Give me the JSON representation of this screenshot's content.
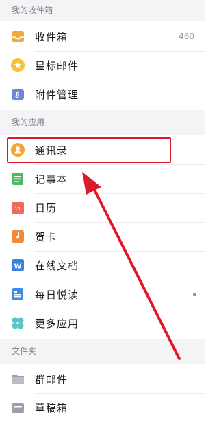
{
  "sections": {
    "mailbox": "我的收件箱",
    "apps": "我的应用",
    "folders": "文件夹"
  },
  "mailbox_items": [
    {
      "label": "收件箱",
      "count": "460",
      "icon": "inbox-icon"
    },
    {
      "label": "星标邮件",
      "icon": "star-icon"
    },
    {
      "label": "附件管理",
      "icon": "attachment-icon"
    }
  ],
  "app_items": [
    {
      "label": "通讯录",
      "icon": "contacts-icon"
    },
    {
      "label": "记事本",
      "icon": "notepad-icon"
    },
    {
      "label": "日历",
      "icon": "calendar-icon",
      "icon_text": "11"
    },
    {
      "label": "贺卡",
      "icon": "greeting-card-icon"
    },
    {
      "label": "在线文档",
      "icon": "document-icon",
      "icon_text": "W"
    },
    {
      "label": "每日悦读",
      "icon": "reading-icon"
    },
    {
      "label": "更多应用",
      "icon": "more-apps-icon"
    }
  ],
  "folder_items": [
    {
      "label": "群邮件",
      "icon": "folder-icon"
    },
    {
      "label": "草稿箱",
      "icon": "drafts-icon"
    }
  ],
  "colors": {
    "highlight": "#e0192a",
    "arrow": "#e0192a",
    "unread_dot": "#e26a6a"
  }
}
